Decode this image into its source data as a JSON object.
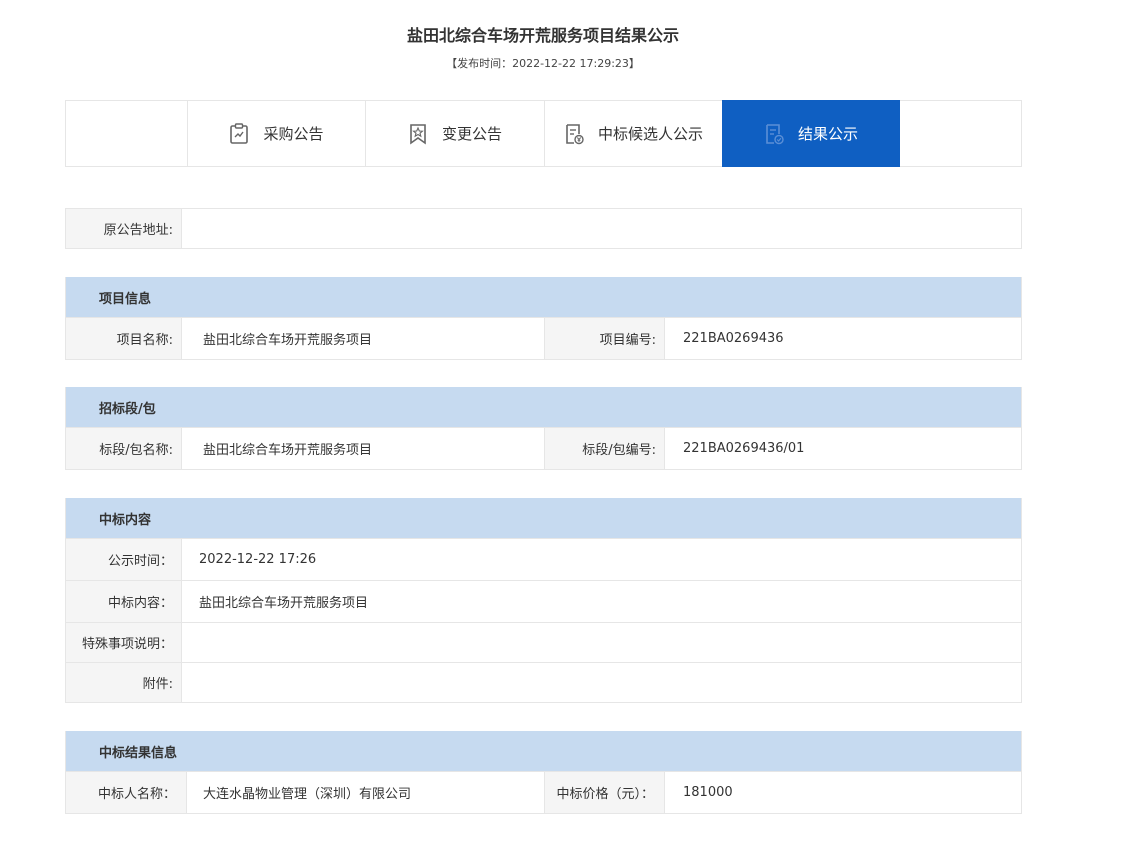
{
  "header": {
    "title": "盐田北综合车场开荒服务项目结果公示",
    "publish_time": "【发布时间：2022-12-22 17:29:23】"
  },
  "tabs": [
    {
      "label": "采购公告",
      "icon": "clipboard-icon",
      "active": false
    },
    {
      "label": "变更公告",
      "icon": "bookmark-star-icon",
      "active": false
    },
    {
      "label": "中标候选人公示",
      "icon": "document-yen-icon",
      "active": false
    },
    {
      "label": "结果公示",
      "icon": "document-check-icon",
      "active": true
    }
  ],
  "original_notice": {
    "label": "原公告地址:",
    "value": ""
  },
  "project_info": {
    "heading": "项目信息",
    "name_label": "项目名称:",
    "name_value": "盐田北综合车场开荒服务项目",
    "code_label": "项目编号:",
    "code_value": "221BA0269436"
  },
  "bid_section": {
    "heading": "招标段/包",
    "name_label": "标段/包名称:",
    "name_value": "盐田北综合车场开荒服务项目",
    "code_label": "标段/包编号:",
    "code_value": "221BA0269436/01"
  },
  "award_content": {
    "heading": "中标内容",
    "rows": [
      {
        "label": "公示时间：",
        "value": "2022-12-22 17:26"
      },
      {
        "label": "中标内容：",
        "value": "盐田北综合车场开荒服务项目"
      },
      {
        "label": "特殊事项说明：",
        "value": ""
      },
      {
        "label": "附件:",
        "value": ""
      }
    ]
  },
  "award_result": {
    "heading": "中标结果信息",
    "winner_label": "中标人名称：",
    "winner_value": "大连水晶物业管理（深圳）有限公司",
    "price_label": "中标价格（元）：",
    "price_value": "181000"
  },
  "colors": {
    "active_tab": "#0f5fc2",
    "section_header": "#c6daf0",
    "label_bg": "#f5f5f5",
    "border": "#e6e6e6"
  }
}
